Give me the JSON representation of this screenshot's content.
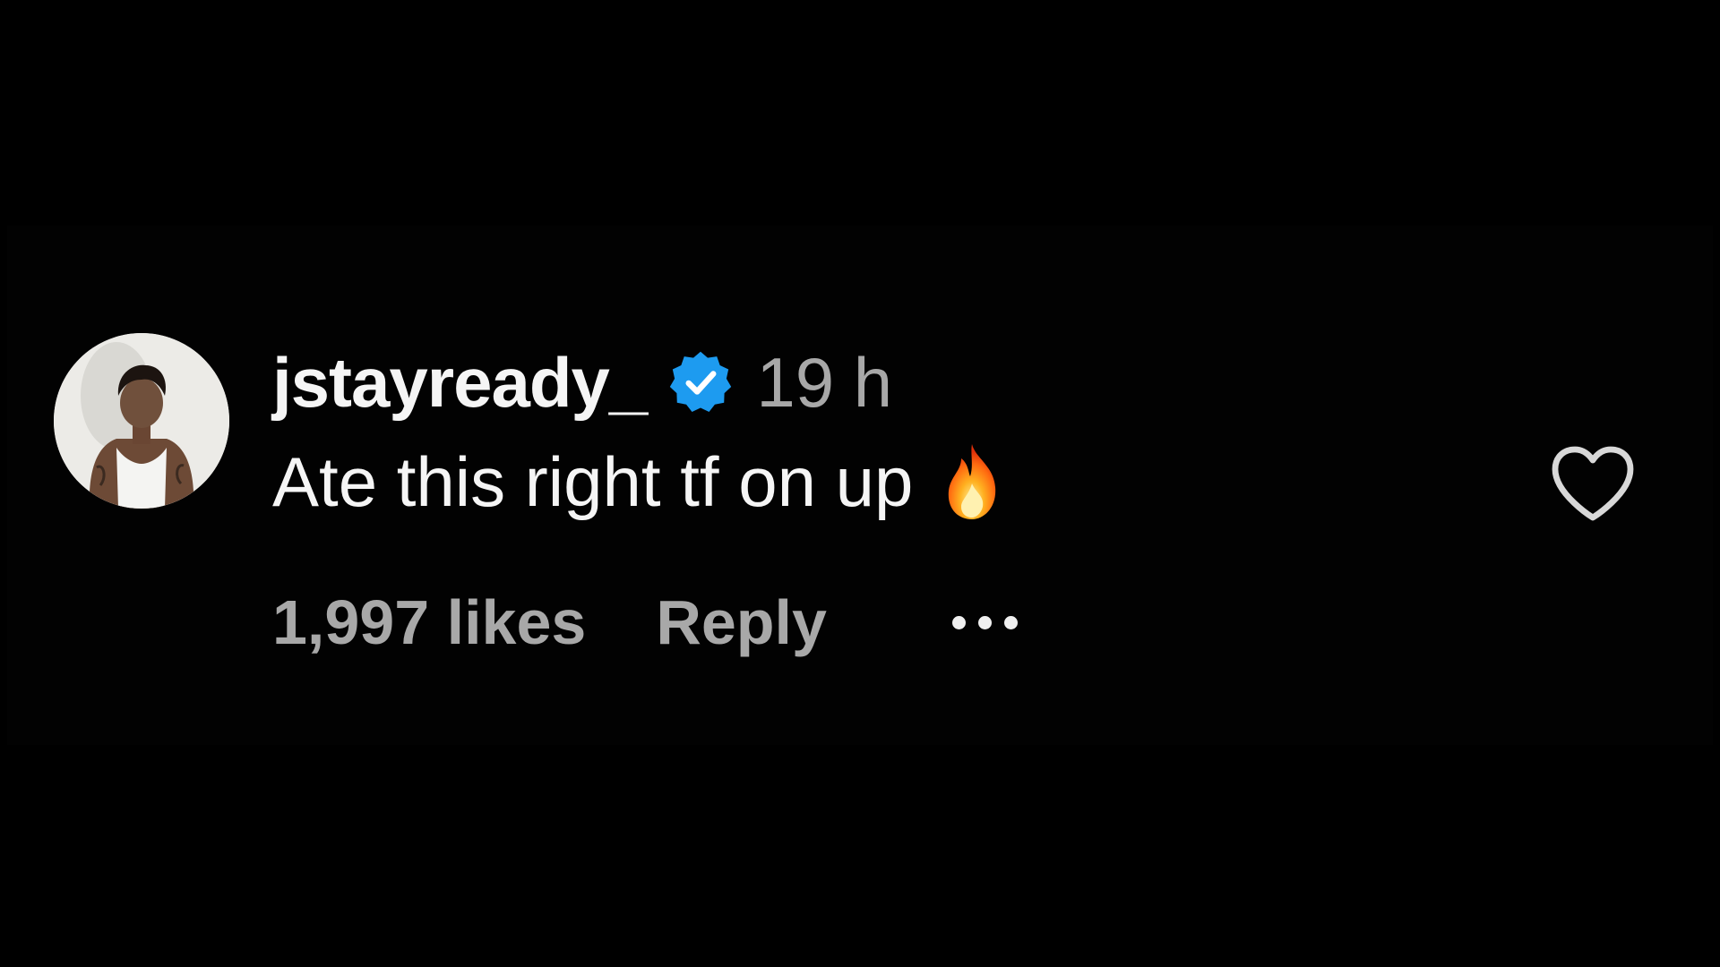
{
  "comment": {
    "username": "jstayready_",
    "verified": true,
    "timestamp": "19 h",
    "text": "Ate this right tf on up",
    "emoji": "fire-emoji",
    "likes_label": "1,997 likes",
    "reply_label": "Reply"
  },
  "icons": {
    "verified": "verified-badge-icon",
    "like": "heart-outline-icon",
    "more": "more-options-icon"
  },
  "colors": {
    "background": "#000000",
    "primary_text": "#f5f5f5",
    "secondary_text": "#a8a8a8",
    "verified_blue": "#1d9bf0"
  }
}
